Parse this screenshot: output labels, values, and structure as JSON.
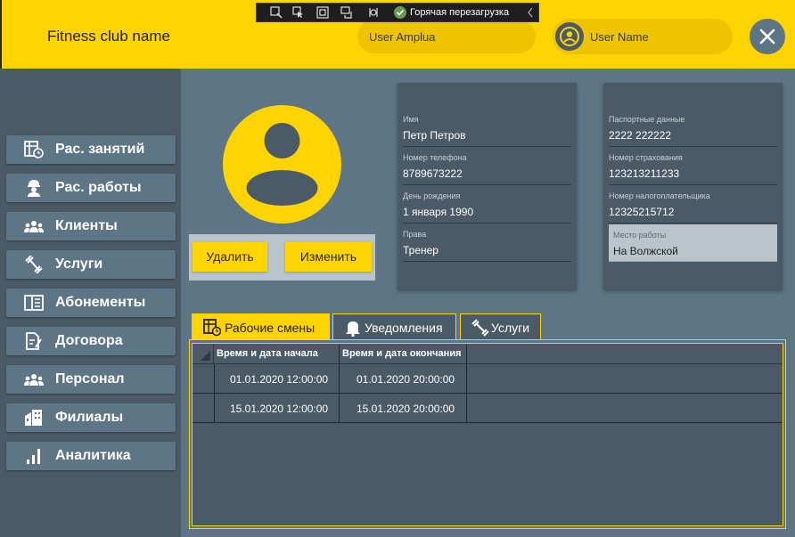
{
  "header": {
    "app_title": "Fitness club name",
    "amplua": "User Amplua",
    "user_name": "User Name",
    "close_icon": "close-icon"
  },
  "debug_toolbar": {
    "hot_reload_label": "Горячая перезагрузка"
  },
  "sidebar": {
    "items": [
      {
        "label": "Рас. занятий",
        "icon": "calendar-clock-icon"
      },
      {
        "label": "Рас. работы",
        "icon": "worker-icon"
      },
      {
        "label": "Клиенты",
        "icon": "group-icon"
      },
      {
        "label": "Услуги",
        "icon": "dumbbell-icon"
      },
      {
        "label": "Абонементы",
        "icon": "book-icon"
      },
      {
        "label": "Договора",
        "icon": "contract-icon"
      },
      {
        "label": "Персонал",
        "icon": "staff-icon"
      },
      {
        "label": "Филиалы",
        "icon": "building-icon"
      },
      {
        "label": "Аналитика",
        "icon": "chart-icon"
      }
    ]
  },
  "profile": {
    "delete_label": "Удалить",
    "edit_label": "Изменить"
  },
  "card_left": {
    "fields": [
      {
        "label": "Имя",
        "value": "Петр Петров"
      },
      {
        "label": "Номер телефона",
        "value": "8789673222"
      },
      {
        "label": "День рождения",
        "value": "1 января 1990"
      },
      {
        "label": "Права",
        "value": "Тренер"
      }
    ]
  },
  "card_right": {
    "fields": [
      {
        "label": "Паспортные данные",
        "value": "2222 222222"
      },
      {
        "label": "Номер страхования",
        "value": "123213211233"
      },
      {
        "label": "Номер налогоплательщика",
        "value": "12325215712"
      },
      {
        "label": "Место работы",
        "value": "На Волжской"
      }
    ]
  },
  "tabs": [
    {
      "label": "Рабочие смены",
      "icon": "schedule-icon",
      "active": true
    },
    {
      "label": "Уведомления",
      "icon": "bell-icon",
      "active": false
    },
    {
      "label": "Услуги",
      "icon": "dumbbell-icon",
      "active": false
    }
  ],
  "grid": {
    "columns": [
      "Время и дата начала",
      "Время и дата окончания"
    ],
    "rows": [
      [
        "01.01.2020 12:00:00",
        "01.01.2020 20:00:00"
      ],
      [
        "15.01.2020 12:00:00",
        "15.01.2020 20:00:00"
      ]
    ]
  },
  "colors": {
    "accent": "#ffd400",
    "panel": "#4a5a66",
    "background": "#5d7585"
  }
}
